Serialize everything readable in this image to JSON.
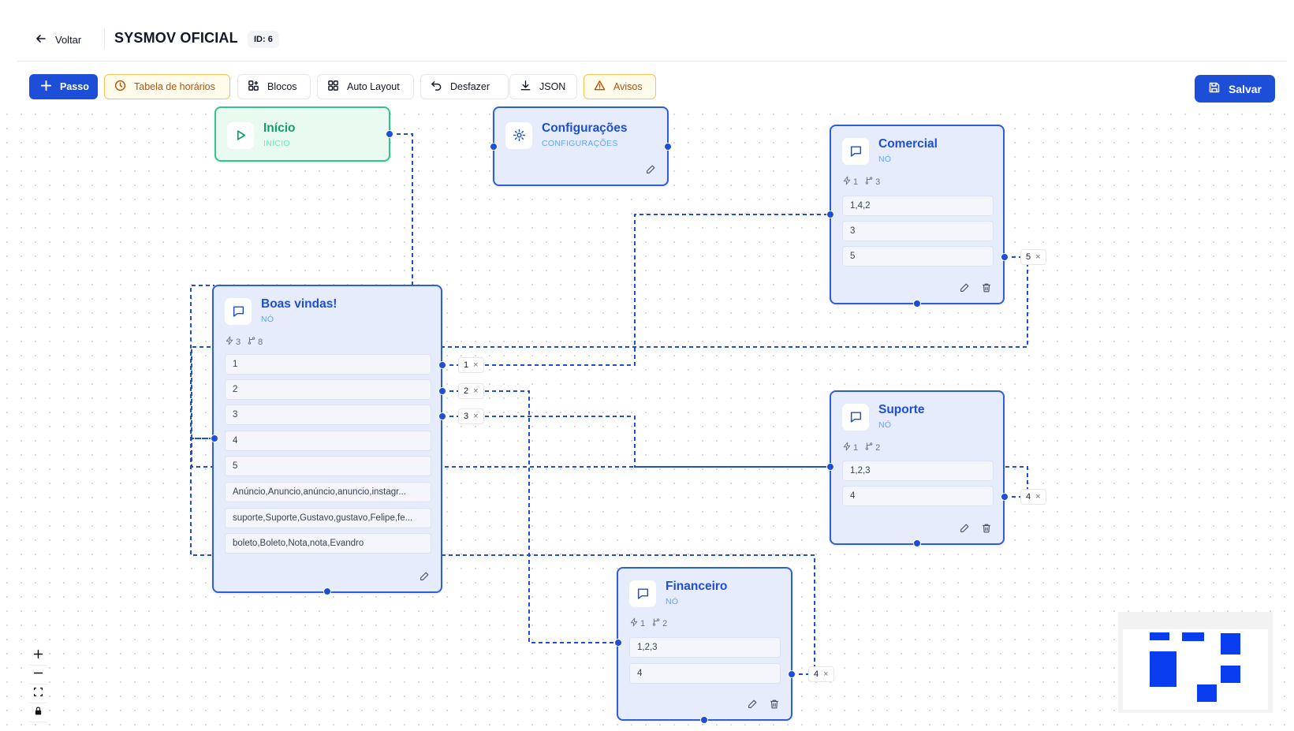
{
  "header": {
    "back_label": "Voltar",
    "title": "SYSMOV OFICIAL",
    "id_badge": "ID: 6"
  },
  "toolbar": {
    "add_step": "Passo",
    "schedule": "Tabela de horários",
    "blocks": "Blocos",
    "auto_layout": "Auto Layout",
    "undo": "Desfazer",
    "json": "JSON",
    "warnings": "Avisos",
    "save": "Salvar"
  },
  "nodes": {
    "inicio": {
      "title": "Início",
      "sub": "INÍCIO"
    },
    "config": {
      "title": "Configurações",
      "sub": "CONFIGURAÇÕES"
    },
    "boas": {
      "title": "Boas vindas!",
      "sub": "NÓ",
      "triggers": "3",
      "branches": "8",
      "options": [
        "1",
        "2",
        "3",
        "4",
        "5",
        "Anúncio,Anuncio,anúncio,anuncio,instagr...",
        "suporte,Suporte,Gustavo,gustavo,Felipe,fe...",
        "boleto,Boleto,Nota,nota,Evandro"
      ]
    },
    "comercial": {
      "title": "Comercial",
      "sub": "NÓ",
      "triggers": "1",
      "branches": "3",
      "options": [
        "1,4,2",
        "3",
        "5"
      ]
    },
    "suporte": {
      "title": "Suporte",
      "sub": "NÓ",
      "triggers": "1",
      "branches": "2",
      "options": [
        "1,2,3",
        "4"
      ]
    },
    "financeiro": {
      "title": "Financeiro",
      "sub": "NÓ",
      "triggers": "1",
      "branches": "2",
      "options": [
        "1,2,3",
        "4"
      ]
    }
  },
  "edge_labels": {
    "boas_1": "1",
    "boas_2": "2",
    "boas_3": "3",
    "comercial_5": "5",
    "suporte_4": "4",
    "financeiro_4": "4"
  },
  "colors": {
    "accent": "#1d4ed8",
    "node_bg": "#e6ecfb",
    "start_border": "#34c38f",
    "warning": "#b45309"
  }
}
